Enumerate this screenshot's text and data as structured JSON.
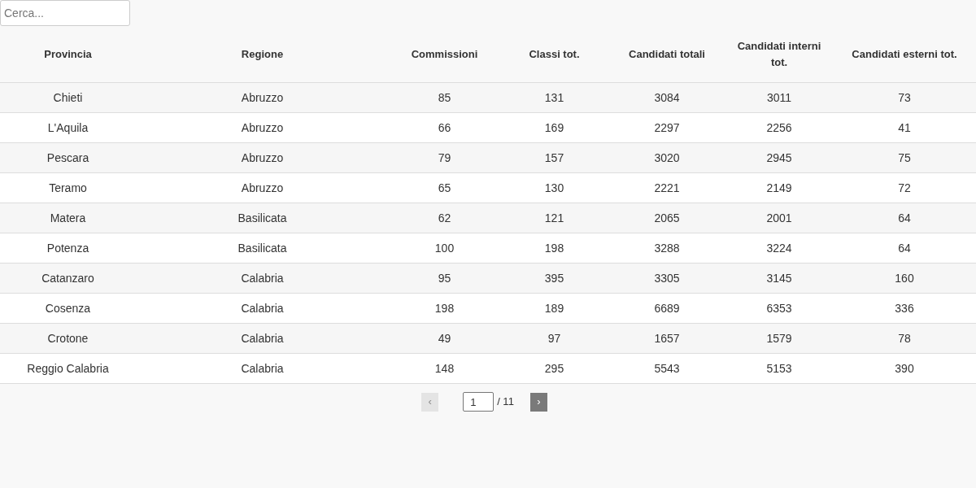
{
  "search": {
    "placeholder": "Cerca..."
  },
  "table": {
    "columns": [
      "Provincia",
      "Regione",
      "Commissioni",
      "Classi tot.",
      "Candidati totali",
      "Candidati interni tot.",
      "Candidati esterni tot."
    ],
    "rows": [
      [
        "Chieti",
        "Abruzzo",
        "85",
        "131",
        "3084",
        "3011",
        "73"
      ],
      [
        "L'Aquila",
        "Abruzzo",
        "66",
        "169",
        "2297",
        "2256",
        "41"
      ],
      [
        "Pescara",
        "Abruzzo",
        "79",
        "157",
        "3020",
        "2945",
        "75"
      ],
      [
        "Teramo",
        "Abruzzo",
        "65",
        "130",
        "2221",
        "2149",
        "72"
      ],
      [
        "Matera",
        "Basilicata",
        "62",
        "121",
        "2065",
        "2001",
        "64"
      ],
      [
        "Potenza",
        "Basilicata",
        "100",
        "198",
        "3288",
        "3224",
        "64"
      ],
      [
        "Catanzaro",
        "Calabria",
        "95",
        "395",
        "3305",
        "3145",
        "160"
      ],
      [
        "Cosenza",
        "Calabria",
        "198",
        "189",
        "6689",
        "6353",
        "336"
      ],
      [
        "Crotone",
        "Calabria",
        "49",
        "97",
        "1657",
        "1579",
        "78"
      ],
      [
        "Reggio Calabria",
        "Calabria",
        "148",
        "295",
        "5543",
        "5153",
        "390"
      ]
    ]
  },
  "pagination": {
    "prev": {
      "label": "‹",
      "disabled": true
    },
    "page": "1",
    "total": "/ 11",
    "next": {
      "label": "›",
      "disabled": false
    }
  }
}
